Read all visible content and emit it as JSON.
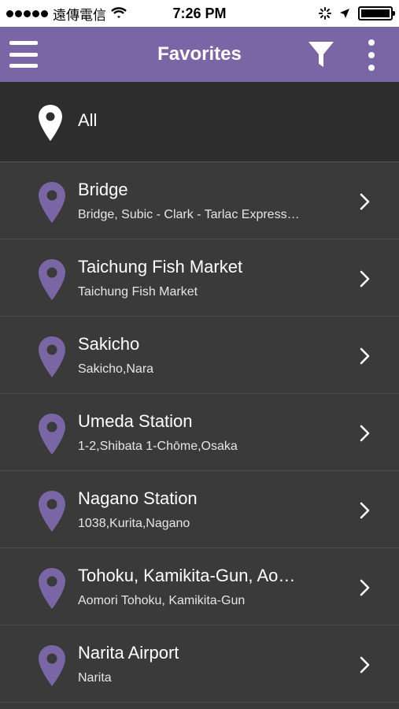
{
  "status_bar": {
    "carrier": "遠傳電信",
    "time": "7:26 PM",
    "icons": [
      "signal-dots",
      "wifi-icon",
      "activity-spinner-icon",
      "location-arrow-icon",
      "battery-icon"
    ],
    "battery_level": 1.0
  },
  "nav": {
    "title": "Favorites",
    "accent": "#7a66a4",
    "icons": [
      "menu-icon",
      "filter-icon",
      "more-vertical-icon"
    ]
  },
  "all_row": {
    "label": "All"
  },
  "pin_color": "#7a66a4",
  "favorites": [
    {
      "title": "Bridge",
      "subtitle": "Bridge, Subic - Clark - Tarlac Express…"
    },
    {
      "title": "Taichung Fish Market",
      "subtitle": "Taichung Fish Market"
    },
    {
      "title": "Sakicho",
      "subtitle": "Sakicho,Nara"
    },
    {
      "title": "Umeda Station",
      "subtitle": "1-2,Shibata 1-Chōme,Osaka"
    },
    {
      "title": "Nagano Station",
      "subtitle": "1038,Kurita,Nagano"
    },
    {
      "title": "Tohoku, Kamikita-Gun, Ao…",
      "subtitle": "Aomori Tohoku, Kamikita-Gun"
    },
    {
      "title": "Narita Airport",
      "subtitle": "Narita"
    }
  ]
}
